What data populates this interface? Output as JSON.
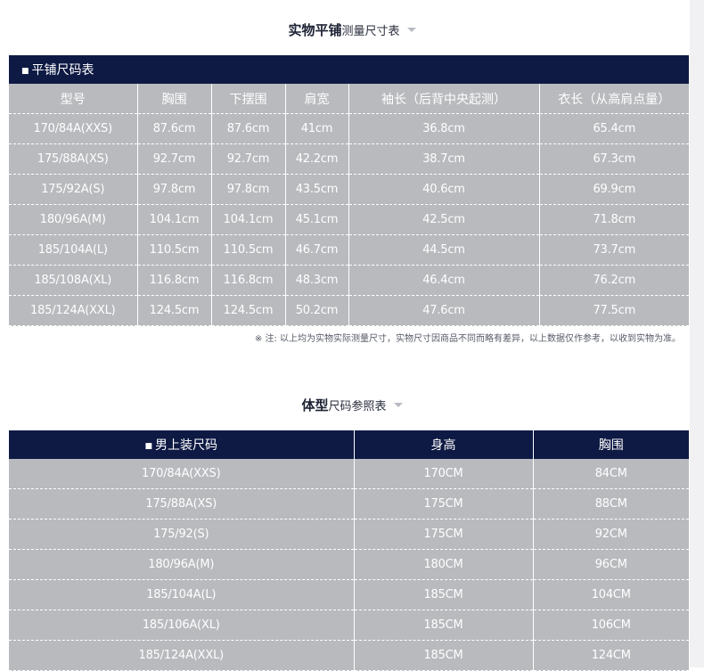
{
  "measure_section": {
    "title_bold": "实物平铺",
    "title_rest": "测量尺寸表",
    "table_caption": "平铺尺码表",
    "columns": [
      "型号",
      "胸围",
      "下摆围",
      "肩宽",
      "袖长（后背中央起测）",
      "衣长（从高肩点量）"
    ],
    "rows": [
      [
        "170/84A(XXS)",
        "87.6cm",
        "87.6cm",
        "41cm",
        "36.8cm",
        "65.4cm"
      ],
      [
        "175/88A(XS)",
        "92.7cm",
        "92.7cm",
        "42.2cm",
        "38.7cm",
        "67.3cm"
      ],
      [
        "175/92A(S)",
        "97.8cm",
        "97.8cm",
        "43.5cm",
        "40.6cm",
        "69.9cm"
      ],
      [
        "180/96A(M)",
        "104.1cm",
        "104.1cm",
        "45.1cm",
        "42.5cm",
        "71.8cm"
      ],
      [
        "185/104A(L)",
        "110.5cm",
        "110.5cm",
        "46.7cm",
        "44.5cm",
        "73.7cm"
      ],
      [
        "185/108A(XL)",
        "116.8cm",
        "116.8cm",
        "48.3cm",
        "46.4cm",
        "76.2cm"
      ],
      [
        "185/124A(XXL)",
        "124.5cm",
        "124.5cm",
        "50.2cm",
        "47.6cm",
        "77.5cm"
      ]
    ],
    "note": "※ 注: 以上均为实物实际测量尺寸，实物尺寸因商品不同而略有差异，以上数据仅作参考，以收到实物为准。"
  },
  "body_section": {
    "title_bold": "体型",
    "title_rest": "尺码参照表",
    "columns": [
      "男上装尺码",
      "身高",
      "胸围"
    ],
    "rows": [
      [
        "170/84A(XXS)",
        "170CM",
        "84CM"
      ],
      [
        "175/88A(XS)",
        "175CM",
        "88CM"
      ],
      [
        "175/92(S)",
        "175CM",
        "92CM"
      ],
      [
        "180/96A(M)",
        "180CM",
        "96CM"
      ],
      [
        "185/104A(L)",
        "185CM",
        "104CM"
      ],
      [
        "185/106A(XL)",
        "185CM",
        "106CM"
      ],
      [
        "185/124A(XXL)",
        "185CM",
        "124CM"
      ]
    ]
  },
  "colors": {
    "header_navy": "#0e1a44",
    "cell_gray": "#b8babd",
    "title_text": "#1c2233"
  },
  "icons": {
    "bullet": "square-bullet",
    "dropdown": "triangle-down"
  }
}
